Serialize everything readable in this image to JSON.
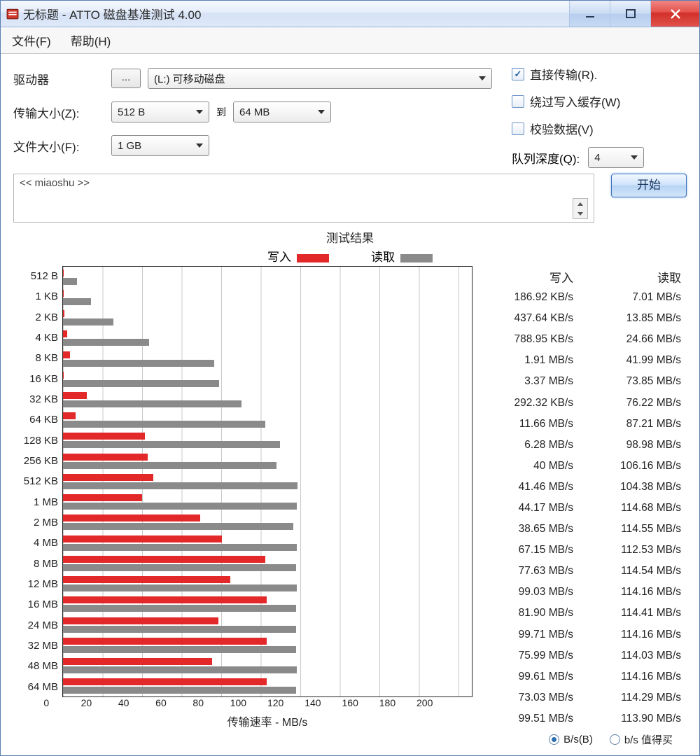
{
  "window": {
    "title": "无标题 - ATTO 磁盘基准测试 4.00"
  },
  "menubar": {
    "file": "文件(F)",
    "help": "帮助(H)"
  },
  "controls": {
    "drive_label": "驱动器",
    "browse_label": "...",
    "drive_value": "(L:) 可移动磁盘",
    "xfer_label": "传输大小(Z):",
    "xfer_from": "512 B",
    "xfer_to_label": "到",
    "xfer_to": "64 MB",
    "file_label": "文件大小(F):",
    "file_value": "1 GB",
    "direct_io": "直接传输(R).",
    "bypass_cache": "绕过写入缓存(W)",
    "verify_data": "校验数据(V)",
    "queue_label": "队列深度(Q):",
    "queue_value": "4",
    "desc_value": "<< miaoshu >>",
    "start_label": "开始"
  },
  "results_title": "测试结果",
  "legend": {
    "write": "写入",
    "read": "读取"
  },
  "xlabel": "传输速率 - MB/s",
  "xmax": 200,
  "xticks": [
    "0",
    "20",
    "40",
    "60",
    "80",
    "100",
    "120",
    "140",
    "160",
    "180",
    "200"
  ],
  "table_headers": {
    "write": "写入",
    "read": "读取"
  },
  "footer": {
    "bps": "B/s(B)",
    "bits": "b/s 值得买"
  },
  "chart_data": {
    "type": "bar",
    "title": "测试结果",
    "xlabel": "传输速率 - MB/s",
    "ylabel": "传输大小",
    "xlim": [
      0,
      200
    ],
    "categories": [
      "512 B",
      "1 KB",
      "2 KB",
      "4 KB",
      "8 KB",
      "16 KB",
      "32 KB",
      "64 KB",
      "128 KB",
      "256 KB",
      "512 KB",
      "1 MB",
      "2 MB",
      "4 MB",
      "8 MB",
      "12 MB",
      "16 MB",
      "24 MB",
      "32 MB",
      "48 MB",
      "64 MB"
    ],
    "series": [
      {
        "name": "写入",
        "values_mb_s": [
          0.18692,
          0.43764,
          0.78895,
          1.91,
          3.37,
          0.29232,
          11.66,
          6.28,
          40,
          41.46,
          44.17,
          38.65,
          67.15,
          77.63,
          99.03,
          81.9,
          99.71,
          75.99,
          99.61,
          73.03,
          99.51
        ],
        "display": [
          "186.92 KB/s",
          "437.64 KB/s",
          "788.95 KB/s",
          "1.91 MB/s",
          "3.37 MB/s",
          "292.32 KB/s",
          "11.66 MB/s",
          "6.28 MB/s",
          "40 MB/s",
          "41.46 MB/s",
          "44.17 MB/s",
          "38.65 MB/s",
          "67.15 MB/s",
          "77.63 MB/s",
          "99.03 MB/s",
          "81.90 MB/s",
          "99.71 MB/s",
          "75.99 MB/s",
          "99.61 MB/s",
          "73.03 MB/s",
          "99.51 MB/s"
        ]
      },
      {
        "name": "读取",
        "values_mb_s": [
          7.01,
          13.85,
          24.66,
          41.99,
          73.85,
          76.22,
          87.21,
          98.98,
          106.16,
          104.38,
          114.68,
          114.55,
          112.53,
          114.54,
          114.16,
          114.41,
          114.16,
          114.03,
          114.16,
          114.29,
          113.9
        ],
        "display": [
          "7.01 MB/s",
          "13.85 MB/s",
          "24.66 MB/s",
          "41.99 MB/s",
          "73.85 MB/s",
          "76.22 MB/s",
          "87.21 MB/s",
          "98.98 MB/s",
          "106.16 MB/s",
          "104.38 MB/s",
          "114.68 MB/s",
          "114.55 MB/s",
          "112.53 MB/s",
          "114.54 MB/s",
          "114.16 MB/s",
          "114.41 MB/s",
          "114.16 MB/s",
          "114.03 MB/s",
          "114.16 MB/s",
          "114.29 MB/s",
          "113.90 MB/s"
        ]
      }
    ]
  }
}
